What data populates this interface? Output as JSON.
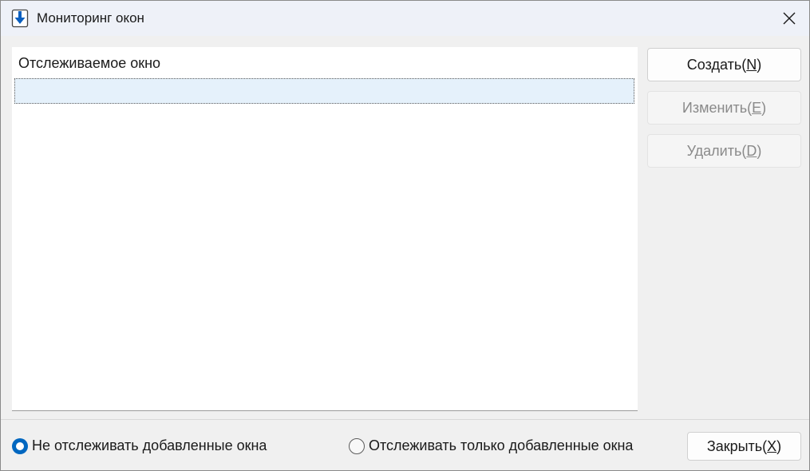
{
  "window": {
    "title": "Мониторинг окон",
    "icon": "download-arrow-icon",
    "accent_color": "#0067c0"
  },
  "list": {
    "column_header": "Отслеживаемое окно",
    "rows": [
      ""
    ],
    "selected_row_color": "#e5f1fb"
  },
  "buttons": {
    "create": {
      "label": "Создать(",
      "mnemonic": "N",
      "suffix": ")",
      "enabled": true
    },
    "edit": {
      "label": "Изменить(",
      "mnemonic": "E",
      "suffix": ")",
      "enabled": false
    },
    "delete": {
      "label": "Удалить(",
      "mnemonic": "D",
      "suffix": ")",
      "enabled": false
    },
    "close": {
      "label": "Закрыть(",
      "mnemonic": "X",
      "suffix": ")",
      "enabled": true
    }
  },
  "options": [
    {
      "label": "Не отслеживать добавленные окна",
      "checked": true
    },
    {
      "label": "Отслеживать только добавленные окна",
      "checked": false
    }
  ]
}
